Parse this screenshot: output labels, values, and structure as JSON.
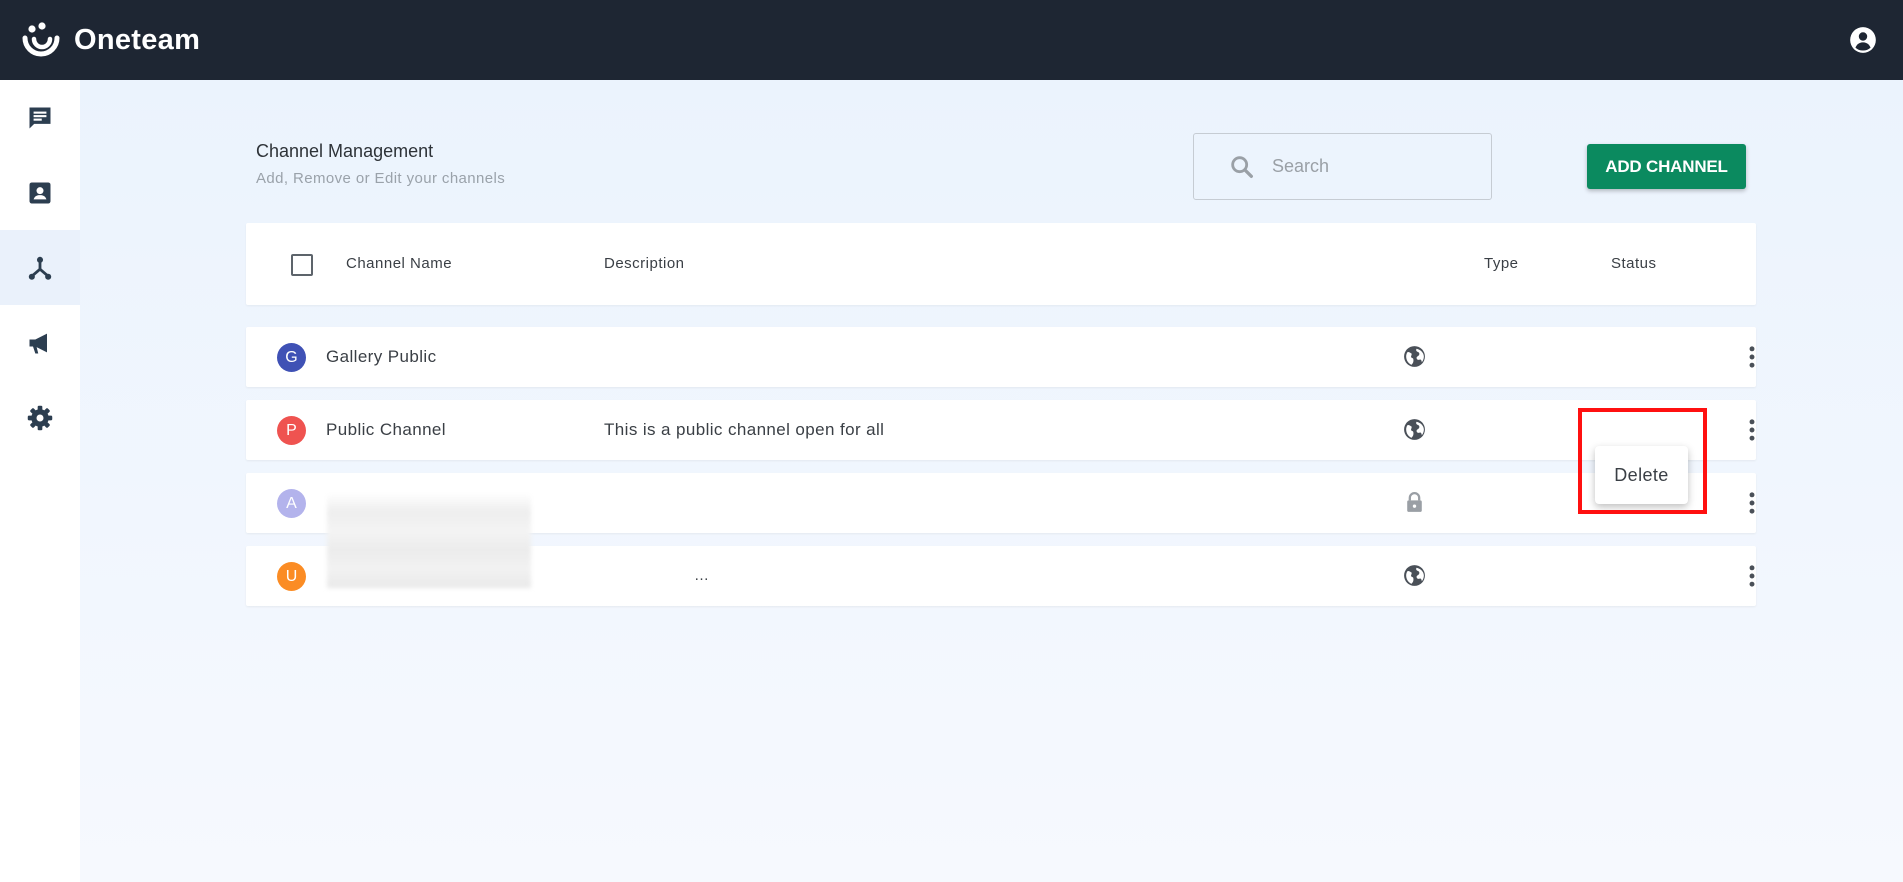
{
  "app": {
    "name": "Oneteam",
    "logo_icon": "oneteam-logo-icon",
    "account_icon": "account-circle-icon"
  },
  "colors": {
    "topbar": "#1e2633",
    "accent": "#0b8a5f",
    "highlight": "#ff1010",
    "sidebar_icon": "#2c3e50"
  },
  "sidebar": {
    "items": [
      {
        "icon": "chat-icon",
        "active": false
      },
      {
        "icon": "contact-card-icon",
        "active": false
      },
      {
        "icon": "channels-hub-icon",
        "active": true
      },
      {
        "icon": "megaphone-icon",
        "active": false
      },
      {
        "icon": "settings-gear-icon",
        "active": false
      }
    ]
  },
  "header": {
    "title": "Channel Management",
    "subtitle": "Add, Remove or Edit your channels"
  },
  "search": {
    "placeholder": "Search",
    "icon": "search-icon"
  },
  "add_button": {
    "label": "ADD CHANNEL"
  },
  "table": {
    "columns": {
      "name": "Channel Name",
      "description": "Description",
      "type": "Type",
      "status": "Status"
    },
    "rows": [
      {
        "initial": "G",
        "avatar_color": "#3f51b5",
        "name": "Gallery Public",
        "description": "",
        "type": "public",
        "type_icon": "globe-icon"
      },
      {
        "initial": "P",
        "avatar_color": "#ef5350",
        "name": "Public Channel",
        "description": "This is a public channel open for all",
        "type": "public",
        "type_icon": "globe-icon"
      },
      {
        "initial": "A",
        "avatar_color": "#b3b3ec",
        "name": "",
        "description": "",
        "type": "private",
        "type_icon": "lock-icon"
      },
      {
        "initial": "U",
        "avatar_color": "#fb8c24",
        "name": "",
        "description": "",
        "type": "public",
        "type_icon": "globe-icon",
        "truncation": "…"
      }
    ]
  },
  "row_menu": {
    "open_on_row": 1,
    "items": [
      "Delete"
    ]
  }
}
